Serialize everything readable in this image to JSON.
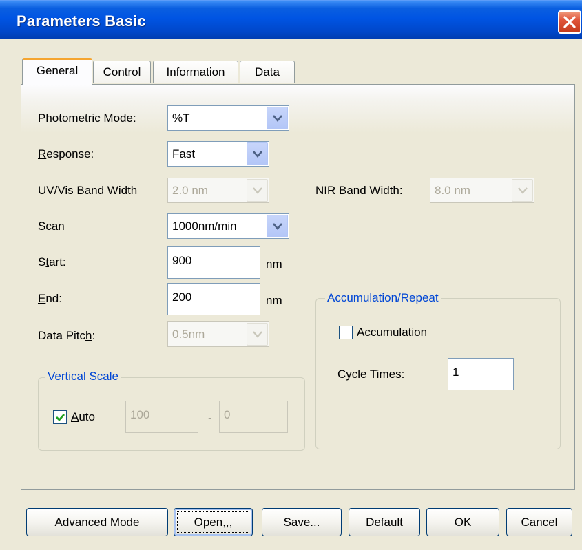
{
  "window": {
    "title": "Parameters  Basic"
  },
  "tabs": [
    {
      "label": "General",
      "active": true
    },
    {
      "label": "Control"
    },
    {
      "label": "Information"
    },
    {
      "label": "Data"
    }
  ],
  "fields": {
    "photometric_mode": {
      "label_pre": "",
      "label_u": "P",
      "label_post": "hotometric Mode:",
      "value": "%T"
    },
    "response": {
      "label_u": "R",
      "label_post": "esponse:",
      "value": "Fast"
    },
    "uvvis_band_width": {
      "label_pre": "UV/Vis ",
      "label_u": "B",
      "label_post": "and Width",
      "value": "2.0 nm"
    },
    "nir_band_width": {
      "label_u": "N",
      "label_post": "IR Band Width:",
      "value": "8.0 nm"
    },
    "scan": {
      "label_pre": "S",
      "label_u": "c",
      "label_post": "an",
      "value": "1000nm/min"
    },
    "start": {
      "label_pre": "S",
      "label_u": "t",
      "label_post": "art:",
      "value": "900",
      "unit": "nm"
    },
    "end": {
      "label_u": "E",
      "label_post": "nd:",
      "value": "200",
      "unit": "nm"
    },
    "data_pitch": {
      "label_pre": "Data Pitc",
      "label_u": "h",
      "label_post": ":",
      "value": "0.5nm"
    }
  },
  "vertical_scale": {
    "title": "Vertical Scale",
    "auto_label_u": "A",
    "auto_label_post": "uto",
    "auto_checked": true,
    "max": "100",
    "separator": "-",
    "min": "0"
  },
  "accumulation": {
    "title": "Accumulation/Repeat",
    "checkbox_pre": "Accu",
    "checkbox_u": "m",
    "checkbox_post": "ulation",
    "checked": false,
    "cycle_pre": "C",
    "cycle_u": "y",
    "cycle_post": "cle Times:",
    "cycle_value": "1"
  },
  "buttons": {
    "advanced": {
      "pre": "Advanced ",
      "u": "M",
      "post": "ode"
    },
    "open": {
      "u": "O",
      "post": "pen,,,"
    },
    "save": {
      "u": "S",
      "post": "ave..."
    },
    "default": {
      "u": "D",
      "post": "efault"
    },
    "ok": "OK",
    "cancel": "Cancel"
  }
}
